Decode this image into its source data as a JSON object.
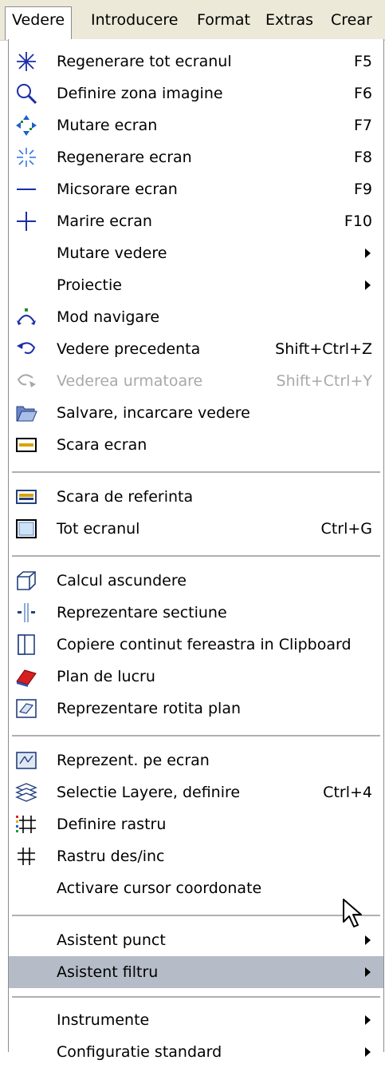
{
  "menubar": {
    "items": [
      {
        "label": "Vedere"
      },
      {
        "label": "Introducere"
      },
      {
        "label": "Format"
      },
      {
        "label": "Extras"
      },
      {
        "label": "Crear"
      }
    ]
  },
  "menu": {
    "items": [
      {
        "label": "Regenerare tot ecranul",
        "shortcut": "F5",
        "icon": "asterisk-icon"
      },
      {
        "label": "Definire zona imagine",
        "shortcut": "F6",
        "icon": "magnifier-icon"
      },
      {
        "label": "Mutare ecran",
        "shortcut": "F7",
        "icon": "pan-arrows-icon"
      },
      {
        "label": "Regenerare ecran",
        "shortcut": "F8",
        "icon": "sparkle-icon"
      },
      {
        "label": "Micsorare ecran",
        "shortcut": "F9",
        "icon": "minus-icon"
      },
      {
        "label": "Marire ecran",
        "shortcut": "F10",
        "icon": "plus-icon"
      },
      {
        "label": "Mutare vedere",
        "submenu": true
      },
      {
        "label": "Proiectie",
        "submenu": true
      },
      {
        "label": "Mod navigare",
        "icon": "navigate-icon"
      },
      {
        "label": "Vedere precedenta",
        "shortcut": "Shift+Ctrl+Z",
        "icon": "undo-arrow-icon"
      },
      {
        "label": "Vederea urmatoare",
        "shortcut": "Shift+Ctrl+Y",
        "icon": "redo-arrow-icon",
        "disabled": true
      },
      {
        "label": "Salvare, incarcare vedere",
        "icon": "folder-open-icon"
      },
      {
        "label": "Scara ecran",
        "icon": "ruler-icon"
      },
      {
        "label": "Scara de referinta",
        "icon": "ruler-reference-icon"
      },
      {
        "label": "Tot ecranul",
        "shortcut": "Ctrl+G",
        "icon": "fullscreen-icon"
      },
      {
        "label": "Calcul ascundere",
        "icon": "cube-icon"
      },
      {
        "label": "Reprezentare sectiune",
        "icon": "section-icon"
      },
      {
        "label": "Copiere continut fereastra in Clipboard",
        "icon": "copy-window-icon"
      },
      {
        "label": "Plan de lucru",
        "icon": "work-plane-icon"
      },
      {
        "label": "Reprezentare rotita plan",
        "icon": "rotated-plane-icon"
      },
      {
        "label": "Reprezent. pe ecran",
        "icon": "screen-display-icon"
      },
      {
        "label": "Selectie Layere, definire",
        "shortcut": "Ctrl+4",
        "icon": "layers-icon"
      },
      {
        "label": "Definire rastru",
        "icon": "grid-define-icon"
      },
      {
        "label": "Rastru des/inc",
        "icon": "grid-icon"
      },
      {
        "label": "Activare cursor coordonate"
      },
      {
        "label": "Asistent punct",
        "submenu": true
      },
      {
        "label": "Asistent filtru",
        "submenu": true,
        "highlighted": true
      },
      {
        "label": "Instrumente",
        "submenu": true
      },
      {
        "label": "Configuratie standard",
        "submenu": true
      }
    ]
  }
}
